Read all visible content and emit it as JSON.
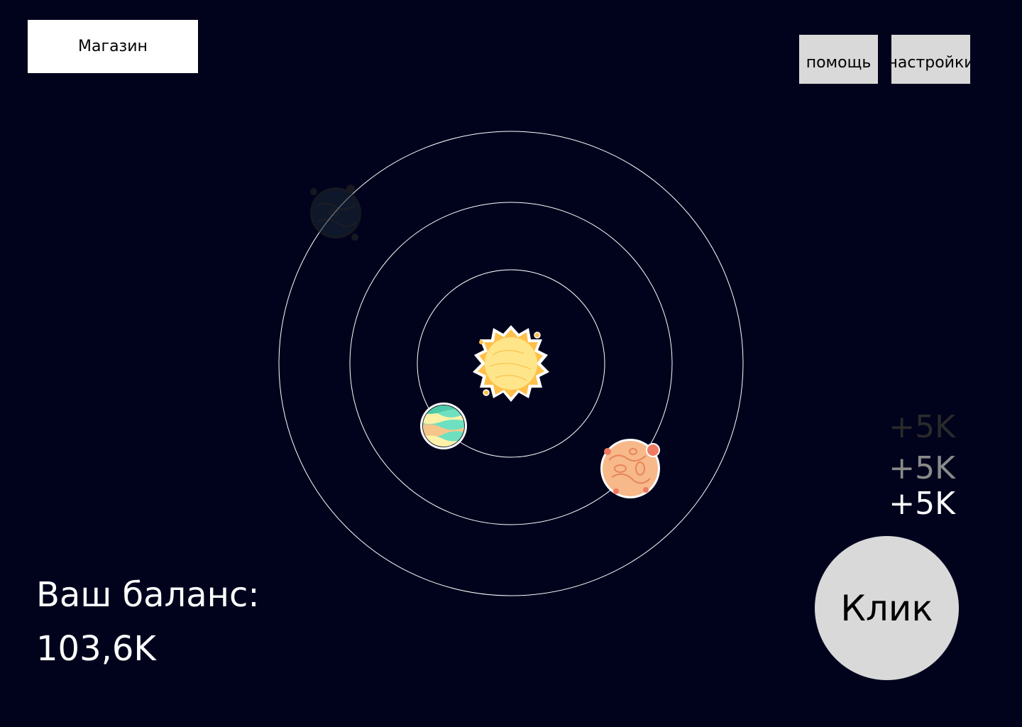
{
  "header": {
    "shop_label": "Магазин",
    "help_label": "помощь",
    "settings_label": "настройки"
  },
  "balance": {
    "label": "Ваш баланс:",
    "value": "103,6K"
  },
  "gains": [
    "+5K",
    "+5K",
    "+5K"
  ],
  "click_label": "Клик",
  "colors": {
    "background": "#01031d",
    "orbit": "#ffffff",
    "button_gray": "#d9d9d9",
    "sun": "#ffd54f",
    "planet_striped": "#6ee0c0",
    "planet_orange": "#f5b27a",
    "planet_dark": "#1b2a35"
  },
  "planets": [
    {
      "icon": "sun-icon"
    },
    {
      "icon": "striped-planet-icon",
      "orbit": 1
    },
    {
      "icon": "orange-planet-icon",
      "orbit": 2
    },
    {
      "icon": "dark-planet-icon",
      "orbit": 3,
      "state": "locked"
    }
  ]
}
